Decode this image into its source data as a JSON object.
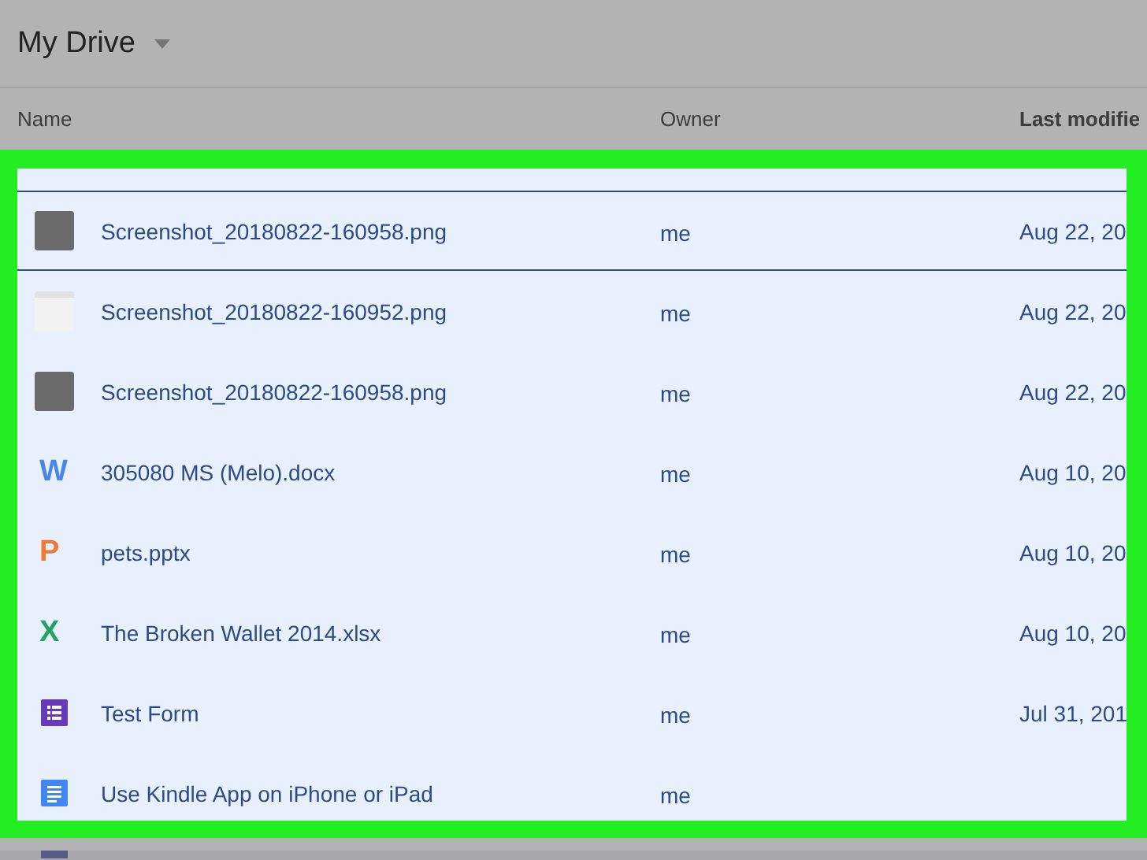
{
  "header": {
    "title": "My Drive"
  },
  "table": {
    "columns": [
      "Name",
      "Owner",
      "Last modifie"
    ],
    "rows": [
      {
        "kind": "thumbdark",
        "name": "Screenshot_20180822-160958.png",
        "owner": "me",
        "modified": "Aug 22, 20",
        "selected": true
      },
      {
        "kind": "thumblight",
        "name": "Screenshot_20180822-160952.png",
        "owner": "me",
        "modified": "Aug 22, 20",
        "selected": false
      },
      {
        "kind": "thumbdark",
        "name": "Screenshot_20180822-160958.png",
        "owner": "me",
        "modified": "Aug 22, 20",
        "selected": false
      },
      {
        "kind": "letter",
        "glyph": "W",
        "color": "#4a86e8",
        "name": "305080 MS (Melo).docx",
        "owner": "me",
        "modified": "Aug 10, 20",
        "selected": false
      },
      {
        "kind": "letter",
        "glyph": "P",
        "color": "#ee7a3a",
        "name": "pets.pptx",
        "owner": "me",
        "modified": "Aug 10, 20",
        "selected": false
      },
      {
        "kind": "letter",
        "glyph": "X",
        "color": "#1fa463",
        "name": "The Broken Wallet 2014.xlsx",
        "owner": "me",
        "modified": "Aug 10, 20",
        "selected": false
      },
      {
        "kind": "form",
        "name": "Test Form",
        "owner": "me",
        "modified": "Jul 31, 201",
        "selected": false
      },
      {
        "kind": "doc",
        "name": "Use Kindle App on iPhone or iPad",
        "owner": "me",
        "selected": false
      }
    ]
  }
}
